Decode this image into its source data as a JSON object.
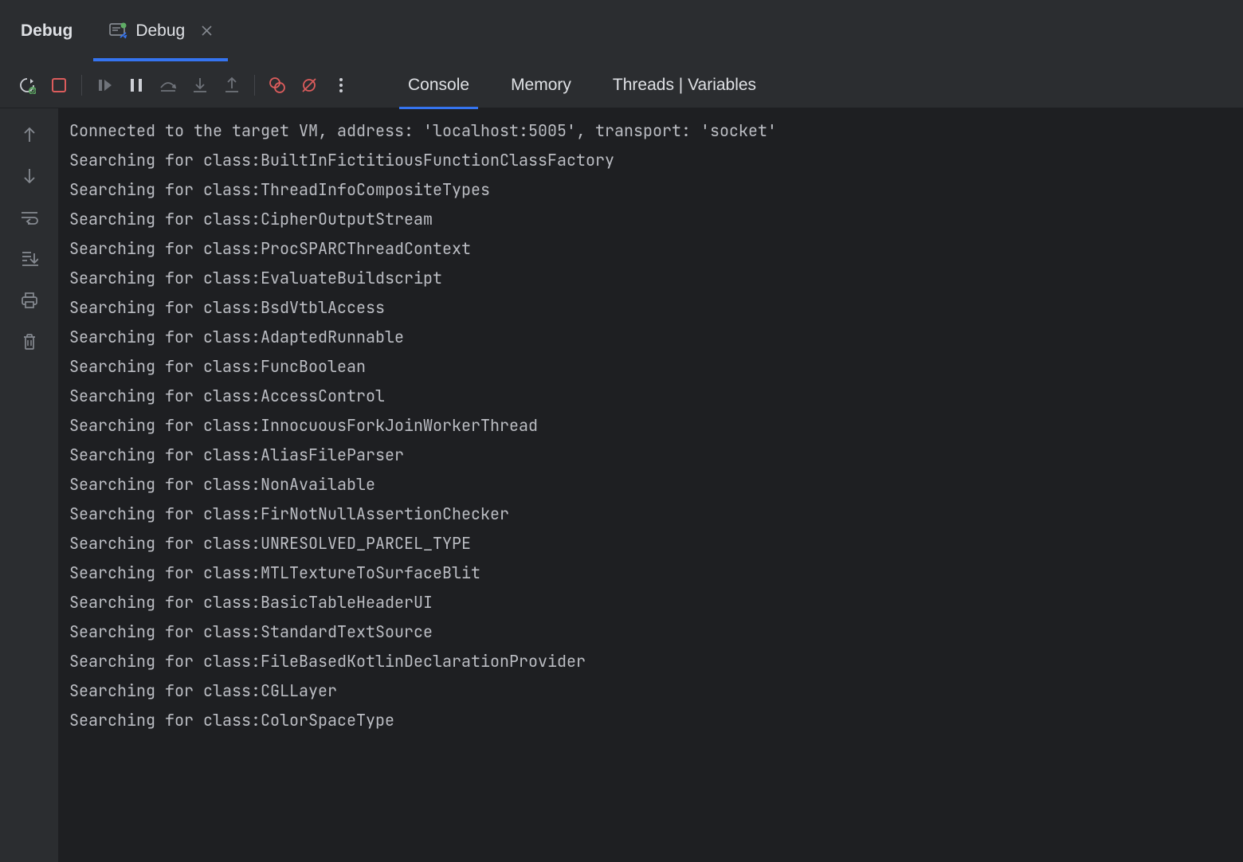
{
  "tool_window": {
    "title": "Debug"
  },
  "tabs": [
    {
      "label": "Debug",
      "active": true
    }
  ],
  "inner_tabs": [
    {
      "label": "Console",
      "active": true
    },
    {
      "label": "Memory",
      "active": false
    },
    {
      "label": "Threads | Variables",
      "active": false
    }
  ],
  "console": {
    "lines": [
      "Connected to the target VM, address: 'localhost:5005', transport: 'socket'",
      "Searching for class:BuiltInFictitiousFunctionClassFactory",
      "Searching for class:ThreadInfoCompositeTypes",
      "Searching for class:CipherOutputStream",
      "Searching for class:ProcSPARCThreadContext",
      "Searching for class:EvaluateBuildscript",
      "Searching for class:BsdVtblAccess",
      "Searching for class:AdaptedRunnable",
      "Searching for class:FuncBoolean",
      "Searching for class:AccessControl",
      "Searching for class:InnocuousForkJoinWorkerThread",
      "Searching for class:AliasFileParser",
      "Searching for class:NonAvailable",
      "Searching for class:FirNotNullAssertionChecker",
      "Searching for class:UNRESOLVED_PARCEL_TYPE",
      "Searching for class:MTLTextureToSurfaceBlit",
      "Searching for class:BasicTableHeaderUI",
      "Searching for class:StandardTextSource",
      "Searching for class:FileBasedKotlinDeclarationProvider",
      "Searching for class:CGLLayer",
      "Searching for class:ColorSpaceType"
    ]
  }
}
